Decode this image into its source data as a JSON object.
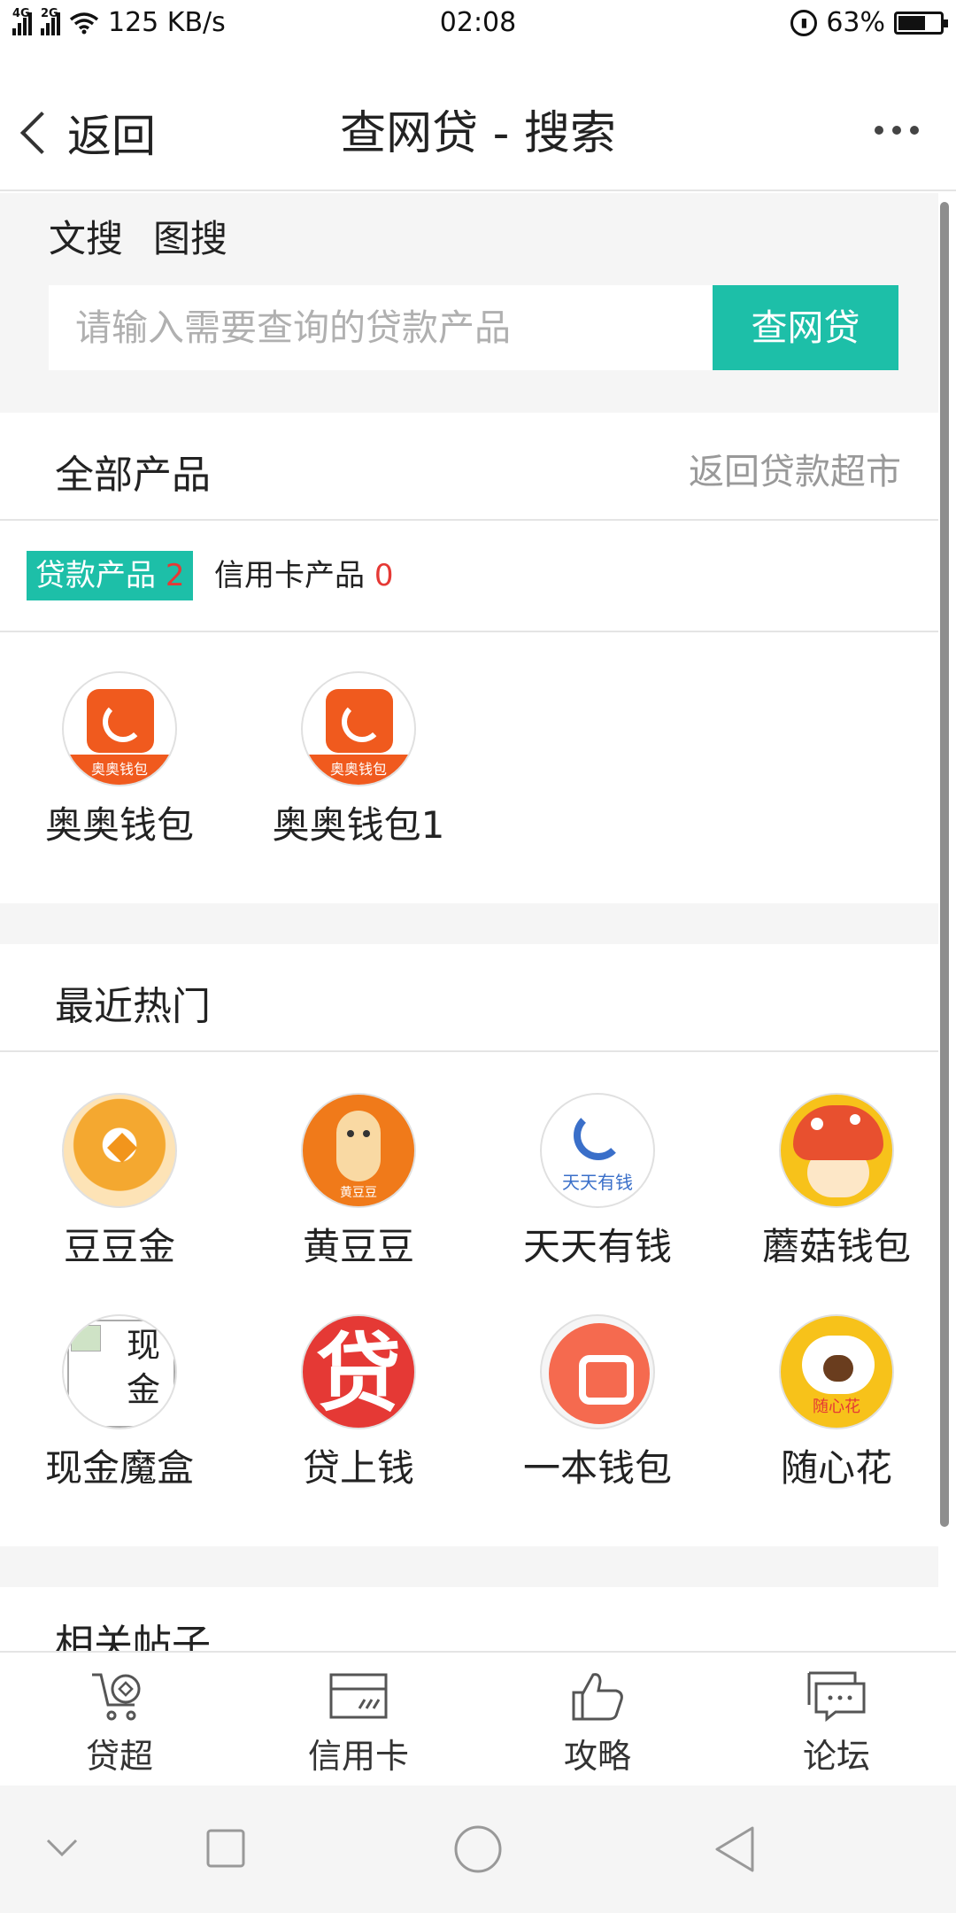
{
  "status_bar": {
    "network": "4G",
    "network2": "2G",
    "speed": "125 KB/s",
    "time": "02:08",
    "battery": "63%",
    "battery_level": 0.63
  },
  "nav": {
    "back_label": "返回",
    "title": "查网贷 - 搜索"
  },
  "search": {
    "tab_text": "文搜",
    "tab_image": "图搜",
    "placeholder": "请输入需要查询的贷款产品",
    "button_label": "查网贷"
  },
  "all_products": {
    "title": "全部产品",
    "link": "返回贷款超市"
  },
  "filters": {
    "loan_label": "贷款产品",
    "loan_count": "2",
    "card_label": "信用卡产品",
    "card_count": "0"
  },
  "products": [
    {
      "name": "奥奥钱包",
      "logo_text": "奥奥钱包"
    },
    {
      "name": "奥奥钱包1",
      "logo_text": "奥奥钱包"
    }
  ],
  "hot": {
    "title": "最近热门",
    "items": [
      {
        "name": "豆豆金"
      },
      {
        "name": "黄豆豆",
        "logo_text": "黄豆豆"
      },
      {
        "name": "天天有钱",
        "logo_text": "天天有钱"
      },
      {
        "name": "蘑菇钱包"
      },
      {
        "name": "现金魔盒",
        "logo_alt": "现金"
      },
      {
        "name": "贷上钱",
        "logo_text": "贷"
      },
      {
        "name": "一本钱包"
      },
      {
        "name": "随心花",
        "logo_text": "随心花"
      }
    ]
  },
  "posts": {
    "title": "相关帖子"
  },
  "tabbar": [
    {
      "label": "贷超",
      "icon": "cart-icon"
    },
    {
      "label": "信用卡",
      "icon": "credit-card-icon"
    },
    {
      "label": "攻略",
      "icon": "thumbs-up-icon"
    },
    {
      "label": "论坛",
      "icon": "chat-bubble-icon"
    }
  ],
  "colors": {
    "accent": "#1dbfa8",
    "count_red": "#e53935"
  }
}
